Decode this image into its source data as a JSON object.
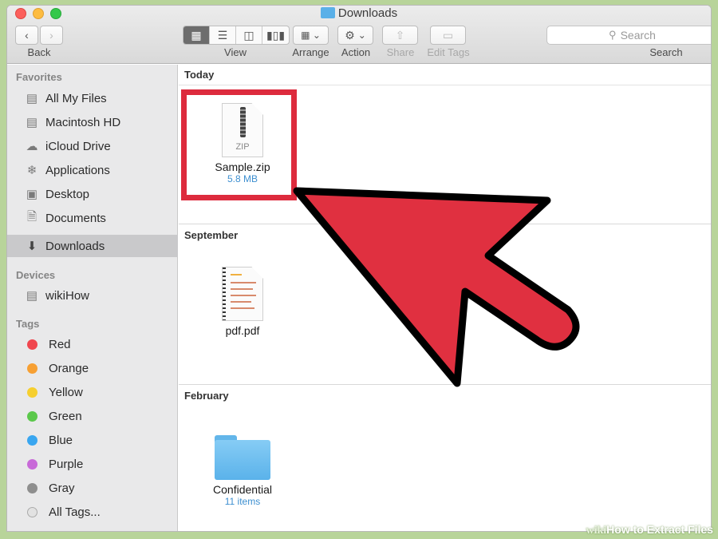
{
  "window": {
    "title": "Downloads"
  },
  "toolbar": {
    "back_label": "Back",
    "view_label": "View",
    "arrange_label": "Arrange",
    "action_label": "Action",
    "share_label": "Share",
    "edit_tags_label": "Edit Tags",
    "search_label": "Search",
    "search_placeholder": "Search"
  },
  "sidebar": {
    "favorites_heading": "Favorites",
    "favorites": [
      {
        "label": "All My Files",
        "icon": "all-files-icon"
      },
      {
        "label": "Macintosh HD",
        "icon": "hard-drive-icon"
      },
      {
        "label": "iCloud Drive",
        "icon": "cloud-icon"
      },
      {
        "label": "Applications",
        "icon": "applications-icon"
      },
      {
        "label": "Desktop",
        "icon": "desktop-icon"
      },
      {
        "label": "Documents",
        "icon": "documents-icon"
      },
      {
        "label": "Downloads",
        "icon": "downloads-icon",
        "selected": true
      }
    ],
    "devices_heading": "Devices",
    "devices": [
      {
        "label": "wikiHow",
        "icon": "hard-drive-icon"
      }
    ],
    "tags_heading": "Tags",
    "tags": [
      {
        "label": "Red",
        "color": "#f0464e"
      },
      {
        "label": "Orange",
        "color": "#f7a033"
      },
      {
        "label": "Yellow",
        "color": "#f6cf2f"
      },
      {
        "label": "Green",
        "color": "#5bc84b"
      },
      {
        "label": "Blue",
        "color": "#39a6f0"
      },
      {
        "label": "Purple",
        "color": "#c86ad8"
      },
      {
        "label": "Gray",
        "color": "#8e8e8e"
      },
      {
        "label": "All Tags...",
        "color": "#e2e2e2"
      }
    ]
  },
  "content": {
    "sections": [
      {
        "heading": "Today",
        "files": [
          {
            "name": "Sample.zip",
            "size": "5.8 MB",
            "icon": "zip-file-icon",
            "icon_text": "ZIP"
          }
        ]
      },
      {
        "heading": "September",
        "files": [
          {
            "name": "pdf.pdf",
            "icon": "pdf-file-icon"
          }
        ]
      },
      {
        "heading": "February",
        "files": [
          {
            "name": "Confidential",
            "size": "11 items",
            "icon": "folder-icon"
          }
        ]
      }
    ]
  },
  "annotation": {
    "highlight_color": "#dd2b3d",
    "arrow_color": "#e03040"
  },
  "watermark": {
    "wiki": "wiki",
    "how": "How",
    "rest": " to Extract Files"
  }
}
